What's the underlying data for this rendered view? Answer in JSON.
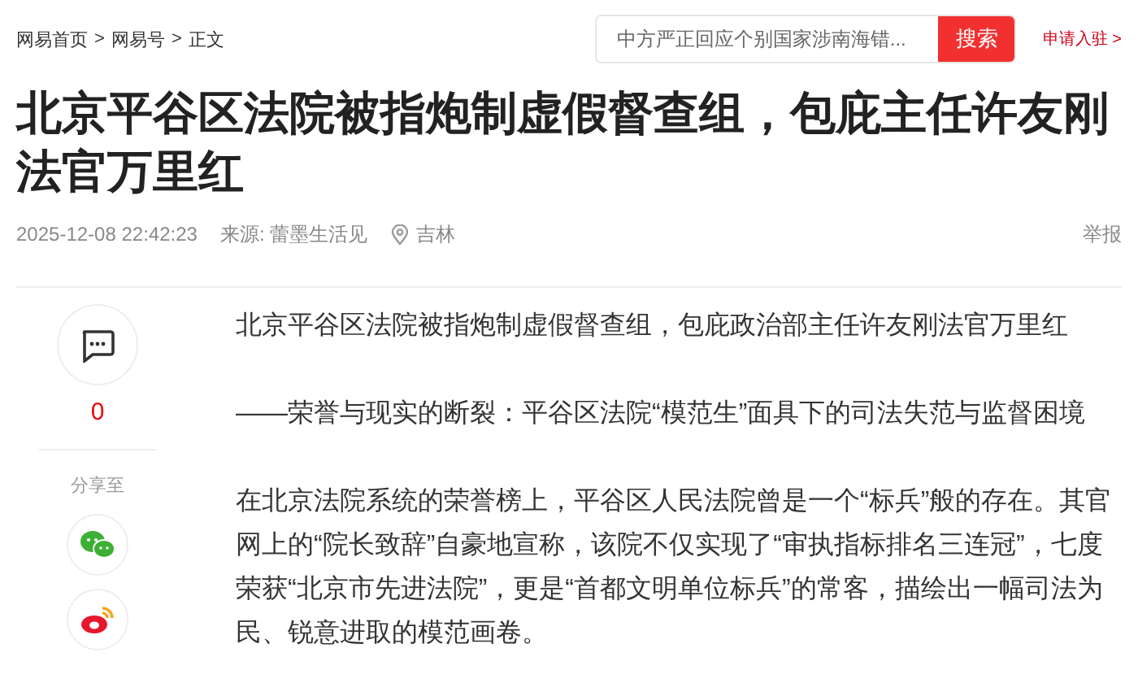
{
  "breadcrumb": [
    "网易首页",
    "网易号",
    "正文"
  ],
  "breadcrumb_separator": ">",
  "search": {
    "placeholder": "中方严正回应个别国家涉南海错...",
    "button": "搜索"
  },
  "apply_link": "申请入驻 >",
  "article": {
    "title": "北京平谷区法院被指炮制虚假督查组，包庇主任许友刚法官万里红",
    "time": "2025-12-08 22:42:23",
    "source": "来源: 蕾墨生活见",
    "location": "吉林",
    "report": "举报",
    "paragraphs": [
      "北京平谷区法院被指炮制虚假督查组，包庇政治部主任许友刚法官万里红",
      "——荣誉与现实的断裂：平谷区法院“模范生”面具下的司法失范与监督困境",
      "在北京法院系统的荣誉榜上，平谷区人民法院曾是一个“标兵”般的存在。其官网上的“院长致辞”自豪地宣称，该院不仅实现了“审执指标排名三连冠”，七度荣获“北京市先进法院”，更是“首都文明单位标兵”的常客，描绘出一幅司法为民、锐意进取的模范画卷。"
    ]
  },
  "sidebar": {
    "comment_count": "0",
    "share_label": "分享至"
  }
}
